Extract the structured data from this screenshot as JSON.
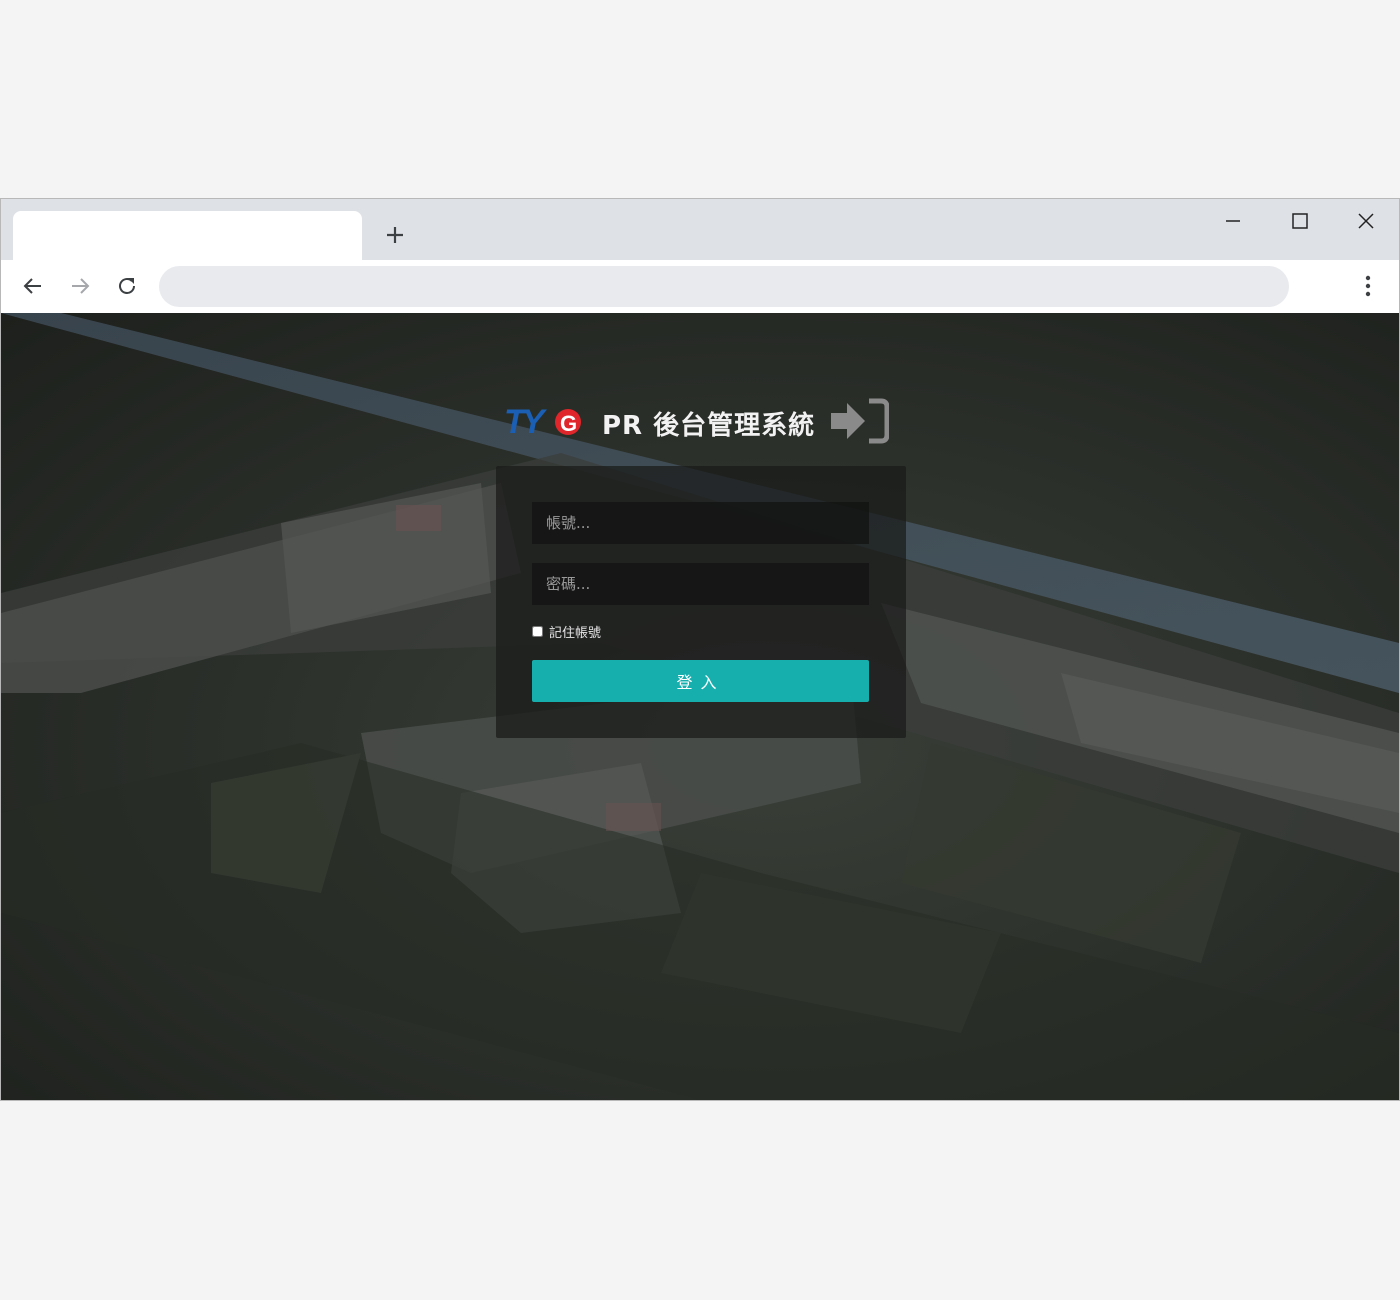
{
  "browser": {
    "tab_title": "",
    "address": "",
    "icons": {
      "new_tab": "plus-icon",
      "minimize": "minimize-icon",
      "maximize": "maximize-icon",
      "close": "close-icon",
      "back": "back-arrow-icon",
      "forward": "forward-arrow-icon",
      "reload": "reload-icon",
      "menu": "more-vertical-icon"
    }
  },
  "login": {
    "logo_text": "TYG",
    "title": "PR 後台管理系統",
    "username_placeholder": "帳號...",
    "password_placeholder": "密碼...",
    "remember_label": "記住帳號",
    "remember_checked": false,
    "submit_label": "登入",
    "icon": "sign-in-icon",
    "colors": {
      "accent": "#17aeae",
      "logo_blue": "#1a5fb4",
      "logo_red": "#e0262a"
    }
  }
}
